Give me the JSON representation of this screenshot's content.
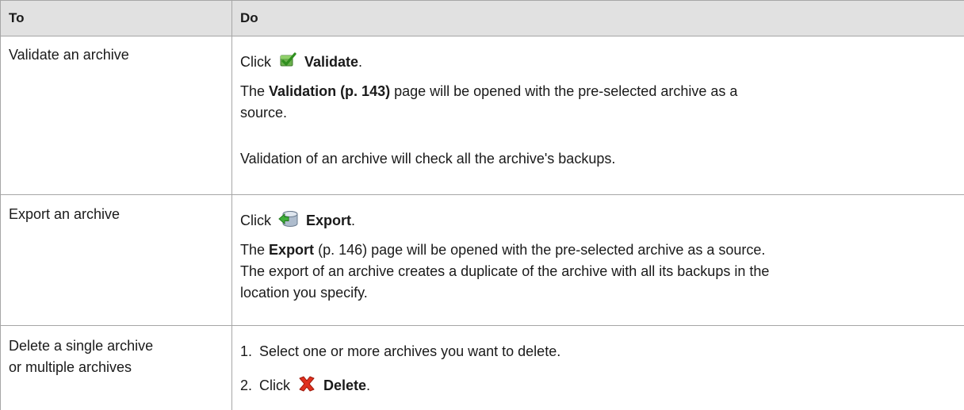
{
  "header": {
    "col_to": "To",
    "col_do": "Do"
  },
  "rows": [
    {
      "to": "Validate an archive",
      "click": "Click",
      "action": "Validate",
      "icon": "validate-icon",
      "p1_bold": "Validation (p. 143)",
      "p1_pre": "The",
      "p1_rest": "page will be opened with the pre-selected archive as a",
      "p1_line2": "source.",
      "p2": "Validation of an archive will check all the archive's backups."
    },
    {
      "to": "Export an archive",
      "click": "Click",
      "action": "Export",
      "icon": "export-icon",
      "p1_pre": "The",
      "p1_bold": "Export",
      "p1_rest": "(p. 146) page will be opened with the pre-selected archive as a source.",
      "p1_line2": "The export of an archive creates a duplicate of the archive with all its backups in the",
      "p1_line3": "location you specify."
    },
    {
      "to_line1": "Delete a single archive",
      "to_line2": "or multiple archives",
      "step1_num": "1.",
      "step1": "Select one or more archives you want to delete.",
      "step2_num": "2.",
      "click": "Click",
      "action": "Delete",
      "icon": "delete-icon"
    }
  ],
  "period": "."
}
